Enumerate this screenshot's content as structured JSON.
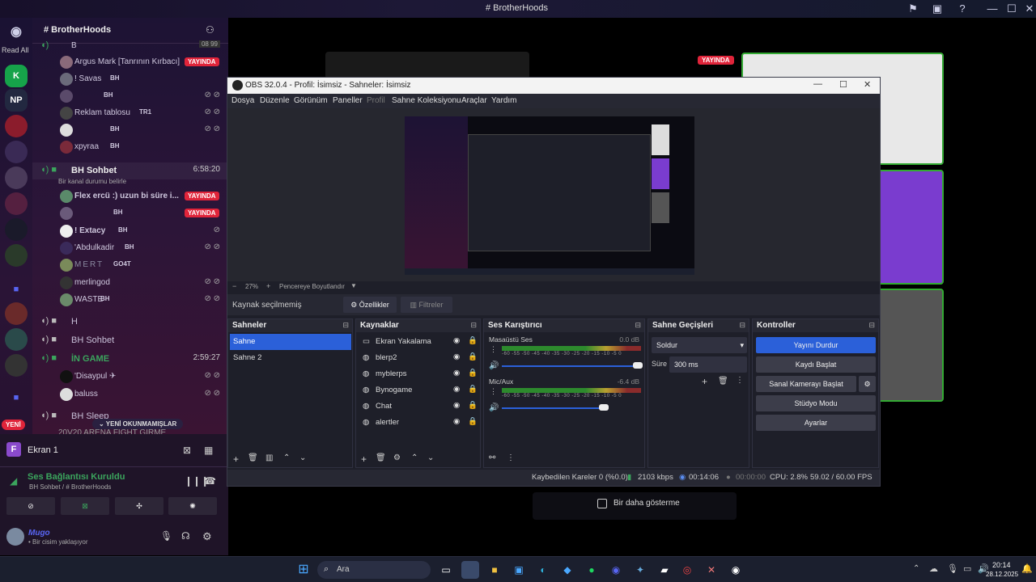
{
  "window": {
    "title": "# BrotherHoods"
  },
  "servers": {
    "read_all": "Read All",
    "np": "NP",
    "new_badge": "YENİ"
  },
  "server": {
    "name": "# BrotherHoods"
  },
  "channels": {
    "top_label": "B",
    "top_count": "08 99",
    "users_top": [
      {
        "name": "Argus Mark [Tanrının Kırbacı]",
        "live": "YAYINDA"
      },
      {
        "name": "! Savas",
        "tag": "BH"
      },
      {
        "name": "",
        "tag": "BH"
      },
      {
        "name": "Reklam tablosu",
        "tag": "TR1"
      },
      {
        "name": "",
        "tag": "BH"
      },
      {
        "name": "xpyraa",
        "tag": "BH"
      }
    ],
    "bh_sohbet": {
      "name": "BH Sohbet",
      "timer": "6:58:20",
      "status": "Bir kanal durumu belirle"
    },
    "users_mid": [
      {
        "name": "Flex ercü :) uzun bi süre i...",
        "live": "YAYINDA"
      },
      {
        "name": "",
        "tag": "BH",
        "live": "YAYINDA"
      },
      {
        "name": "! Extacy",
        "tag": "BH"
      },
      {
        "name": "'Abdulkadir",
        "tag": "BH"
      },
      {
        "name": "MERT",
        "tag": "GO4T"
      },
      {
        "name": "merlingod",
        "tag": ""
      },
      {
        "name": "WASTE",
        "tag": "BH"
      }
    ],
    "h_channel": "H",
    "bh_sohbet2": "BH Sohbet",
    "in_game": {
      "name": "İN GAME",
      "timer": "2:59:27"
    },
    "users_game": [
      {
        "name": "'Disaypul ✈"
      },
      {
        "name": "baluss"
      }
    ],
    "bh_sleep": "BH Sleep",
    "arena": "20V20 ARENA FIGHT GIRME",
    "unread": "YENİ OKUNMAMIŞLAR"
  },
  "bottom": {
    "screen": "Ekran 1",
    "voice_status": "Ses Bağlantısı Kuruldu",
    "voice_channel": "BH Sohbet / # BrotherHoods",
    "user_name": "Mugo",
    "user_status": "• Bir cisim yaklaşıyor"
  },
  "stream": {
    "live": "YAYINDA",
    "dont_show": "Bir daha gösterme"
  },
  "obs": {
    "title": "OBS 32.0.4 - Profil: İsimsiz - Sahneler: İsimsiz",
    "menu": [
      "Dosya",
      "Düzenle",
      "Görünüm",
      "Paneller",
      "Profil",
      "Sahne Koleksiyonu",
      "Araçlar",
      "Yardım"
    ],
    "zoom": "27%",
    "fit": "Pencereye Boyutlandır",
    "no_source": "Kaynak seçilmemiş",
    "properties": "Özellikler",
    "filters": "Filtreler",
    "scenes_title": "Sahneler",
    "scenes": [
      "Sahne",
      "Sahne 2"
    ],
    "sources_title": "Kaynaklar",
    "sources": [
      "Ekran Yakalama",
      "blerp2",
      "myblerps",
      "Bynogame",
      "Chat",
      "alertler"
    ],
    "mixer_title": "Ses Karıştırıcı",
    "mixer": [
      {
        "name": "Masaüstü Ses",
        "db": "0.0 dB"
      },
      {
        "name": "Mic/Aux",
        "db": "-6.4 dB"
      }
    ],
    "mixer_scale": "-60 -55 -50 -45 -40 -35 -30 -25 -20 -15 -10 -5 0",
    "transitions_title": "Sahne Geçişleri",
    "transition": "Soldur",
    "duration_label": "Süre",
    "duration": "300 ms",
    "controls_title": "Kontroller",
    "controls": [
      "Yayını Durdur",
      "Kaydı Başlat",
      "Sanal Kamerayı Başlat",
      "Stüdyo Modu",
      "Ayarlar"
    ],
    "status": {
      "dropped": "Kaybedilen Kareler 0 (%0.0)",
      "bitrate": "2103 kbps",
      "stream_time": "00:14:06",
      "rec_time": "00:00:00",
      "cpu": "CPU: 2.8%",
      "fps": "59.02 / 60.00 FPS"
    }
  },
  "taskbar": {
    "search": "Ara",
    "time": "20:14",
    "date": "28.12.2025"
  },
  "colors": {
    "accent": "#2b60d9",
    "live": "#e0243a",
    "discord": "#5865f2"
  }
}
